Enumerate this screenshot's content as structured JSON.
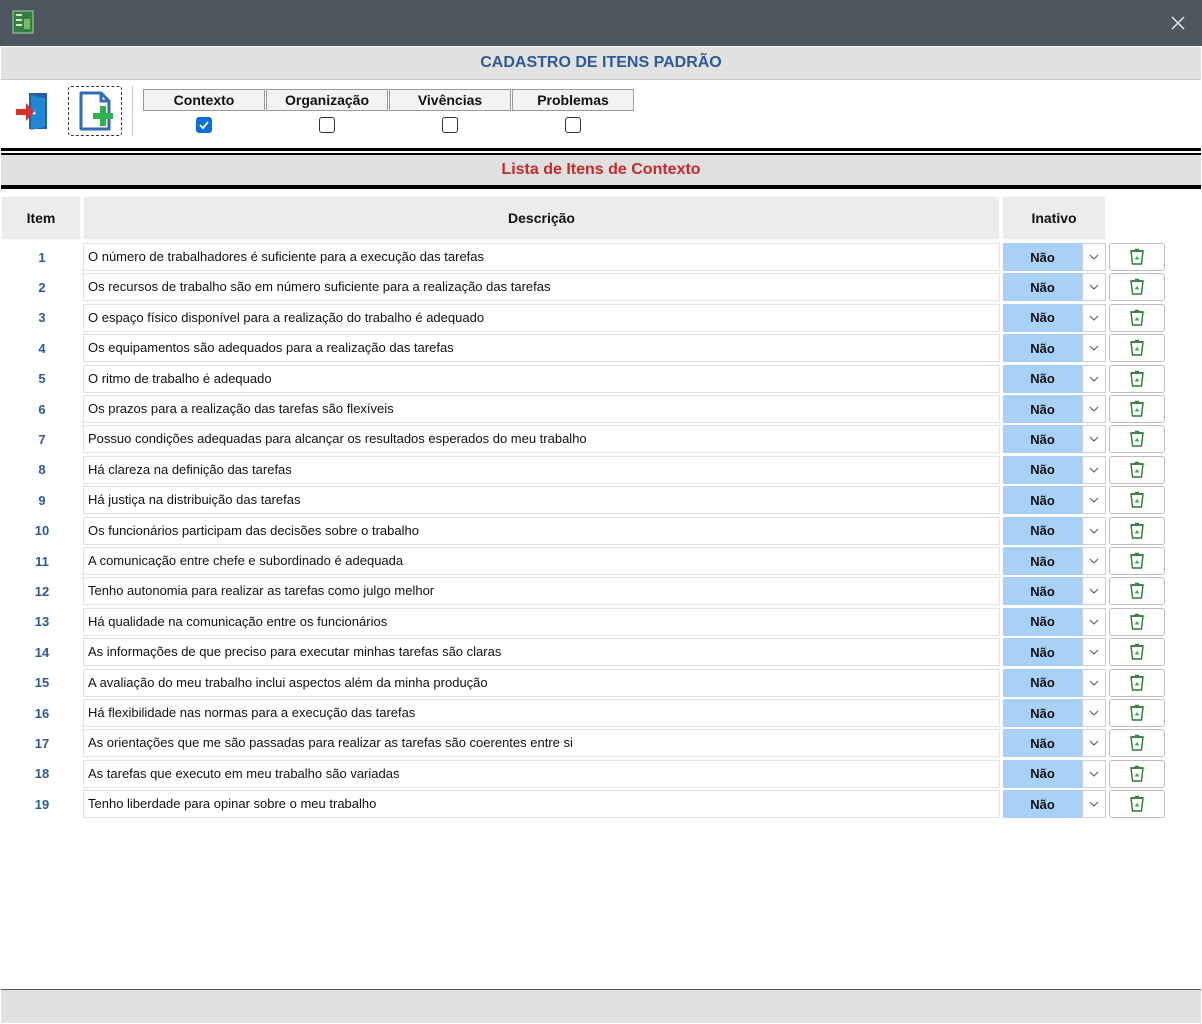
{
  "window": {
    "app_icon": "app-icon",
    "close_icon": "close-icon"
  },
  "header": {
    "title": "CADASTRO DE ITENS PADRÃO"
  },
  "toolbar": {
    "exit_icon": "exit-door-icon",
    "add_icon": "add-document-icon"
  },
  "tabs": [
    {
      "label": "Contexto",
      "checked": true
    },
    {
      "label": "Organização",
      "checked": false
    },
    {
      "label": "Vivências",
      "checked": false
    },
    {
      "label": "Problemas",
      "checked": false
    }
  ],
  "list": {
    "title": "Lista de Itens de Contexto",
    "columns": {
      "item": "Item",
      "description": "Descrição",
      "inactive": "Inativo"
    },
    "rows": [
      {
        "num": "1",
        "desc": "O número de trabalhadores é suficiente para a execução das tarefas",
        "inactive": "Não"
      },
      {
        "num": "2",
        "desc": "Os recursos de trabalho são em número suficiente para a realização das tarefas",
        "inactive": "Não"
      },
      {
        "num": "3",
        "desc": "O espaço físico disponível para a realização do trabalho é adequado",
        "inactive": "Não"
      },
      {
        "num": "4",
        "desc": "Os equipamentos são adequados para a realização das tarefas",
        "inactive": "Não"
      },
      {
        "num": "5",
        "desc": "O ritmo de trabalho é adequado",
        "inactive": "Não"
      },
      {
        "num": "6",
        "desc": "Os prazos para a realização das tarefas são flexíveis",
        "inactive": "Não"
      },
      {
        "num": "7",
        "desc": "Possuo condições adequadas para alcançar os resultados esperados do meu trabalho",
        "inactive": "Não"
      },
      {
        "num": "8",
        "desc": "Há clareza na definição das tarefas",
        "inactive": "Não"
      },
      {
        "num": "9",
        "desc": "Há justiça na distribuição das tarefas",
        "inactive": "Não"
      },
      {
        "num": "10",
        "desc": "Os funcionários participam das decisões sobre o trabalho",
        "inactive": "Não"
      },
      {
        "num": "11",
        "desc": "A comunicação entre chefe e subordinado é adequada",
        "inactive": "Não"
      },
      {
        "num": "12",
        "desc": "Tenho autonomia para realizar as tarefas como julgo melhor",
        "inactive": "Não"
      },
      {
        "num": "13",
        "desc": "Há qualidade na comunicação entre os funcionários",
        "inactive": "Não"
      },
      {
        "num": "14",
        "desc": "As informações de que preciso para executar minhas tarefas são claras",
        "inactive": "Não"
      },
      {
        "num": "15",
        "desc": "A avaliação do meu trabalho inclui aspectos além da minha produção",
        "inactive": "Não"
      },
      {
        "num": "16",
        "desc": "Há flexibilidade nas normas para a execução das tarefas",
        "inactive": "Não"
      },
      {
        "num": "17",
        "desc": "As orientações que me são passadas para realizar as tarefas são coerentes entre si",
        "inactive": "Não"
      },
      {
        "num": "18",
        "desc": "As tarefas que executo em meu trabalho são variadas",
        "inactive": "Não"
      },
      {
        "num": "19",
        "desc": "Tenho liberdade para opinar sobre o meu trabalho",
        "inactive": "Não"
      }
    ]
  },
  "colors": {
    "title_blue": "#2c5b95",
    "list_title_red": "#c62a2a",
    "select_blue": "#a9d1f7",
    "titlebar": "#4e5660"
  }
}
